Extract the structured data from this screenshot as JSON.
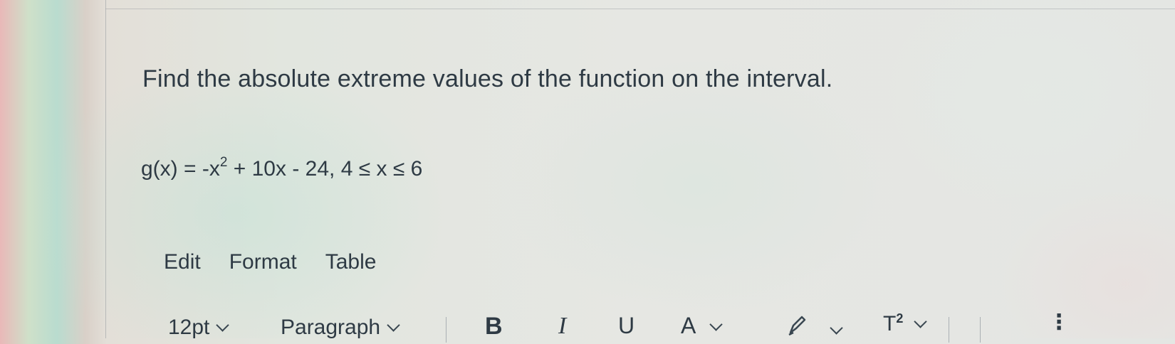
{
  "question": {
    "prompt": "Find the absolute extreme values of the function on the interval.",
    "formula_before": "g(x) = -x",
    "formula_exponent": "2",
    "formula_after": " + 10x - 24, 4 ≤ x ≤ 6"
  },
  "editor": {
    "menu": {
      "edit": "Edit",
      "format": "Format",
      "table": "Table"
    },
    "toolbar": {
      "font_size": "12pt",
      "block_format": "Paragraph",
      "bold": "B",
      "italic": "I",
      "underline": "U",
      "text_color": "A",
      "superscript_base": "T",
      "superscript_exp": "2",
      "more": "⋮"
    }
  },
  "colors": {
    "text": "#2e3a44",
    "divider": "#aab0b4"
  }
}
